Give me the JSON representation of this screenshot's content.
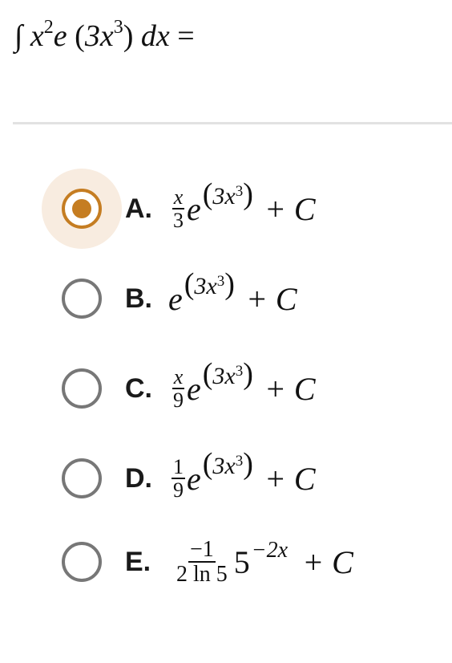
{
  "question": {
    "integral_sign": "∫",
    "integrand_base": "x",
    "integrand_exp": "2",
    "integrand_func": "e",
    "arg_open": "(",
    "arg_body": "3x",
    "arg_exp": "3",
    "arg_close": ")",
    "differential": "dx",
    "equals": "="
  },
  "options": [
    {
      "letter": "A.",
      "selected": true,
      "frac_num": "x",
      "frac_den": "3",
      "base": "e",
      "exp_open": "(",
      "exp_body": "3x",
      "exp_power": "3",
      "exp_close": ")",
      "tail": "+ C"
    },
    {
      "letter": "B.",
      "selected": false,
      "base": "e",
      "exp_open": "(",
      "exp_body": "3x",
      "exp_power": "3",
      "exp_close": ")",
      "tail": "+ C"
    },
    {
      "letter": "C.",
      "selected": false,
      "frac_num": "x",
      "frac_den": "9",
      "base": "e",
      "exp_open": "(",
      "exp_body": "3x",
      "exp_power": "3",
      "exp_close": ")",
      "tail": "+ C"
    },
    {
      "letter": "D.",
      "selected": false,
      "frac_num": "1",
      "frac_den": "9",
      "base": "e",
      "exp_open": "(",
      "exp_body": "3x",
      "exp_power": "3",
      "exp_close": ")",
      "tail": "+ C"
    },
    {
      "letter": "E.",
      "selected": false,
      "frac_num": "−1",
      "frac_den": "2 ln 5",
      "base": "5",
      "exp_text": "−2x",
      "tail": "+ C"
    }
  ],
  "colors": {
    "accent": "#c57d22",
    "accent_halo": "#f8ece0",
    "radio_border": "#777777",
    "divider": "#e2e2e2"
  }
}
